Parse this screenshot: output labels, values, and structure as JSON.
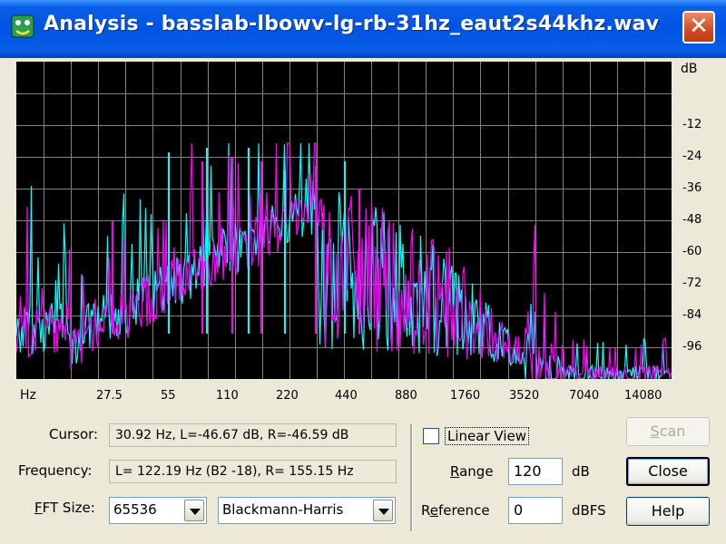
{
  "window": {
    "title": "Analysis - basslab-lbowv-lg-rb-31hz_eaut2s44khz.wav",
    "close_glyph": "✕"
  },
  "plot": {
    "y_unit": "dB",
    "y_labels": [
      "-12",
      "-24",
      "-36",
      "-48",
      "-60",
      "-72",
      "-84",
      "-96"
    ],
    "x_unit": "Hz",
    "x_labels": [
      "27.5",
      "55",
      "110",
      "220",
      "440",
      "880",
      "1760",
      "3520",
      "7040",
      "14080"
    ],
    "colors": {
      "background": "#000000",
      "grid": "#828282",
      "left": "#ff00ff",
      "right": "#00ffff"
    }
  },
  "controls": {
    "cursor_label": "Cursor:",
    "cursor_value": "30.92 Hz, L=-46.67 dB, R=-46.59 dB",
    "frequency_label": "Frequency:",
    "frequency_value": "L= 122.19 Hz (B2 -18), R= 155.15 Hz",
    "fft_label_accel": "F",
    "fft_label_rest": "FT Size:",
    "fft_value": "65536",
    "window_value": "Blackmann-Harris",
    "linear_view_label": "Linear View",
    "linear_view_checked": false,
    "range_label_accel": "R",
    "range_label_rest": "ange",
    "range_value": "120",
    "range_unit": "dB",
    "reference_label_pre": "R",
    "reference_label_accel": "e",
    "reference_label_rest": "ference",
    "reference_value": "0",
    "reference_unit": "dBFS"
  },
  "buttons": {
    "scan_accel": "S",
    "scan_rest": "can",
    "close": "Close",
    "help": "Help"
  }
}
